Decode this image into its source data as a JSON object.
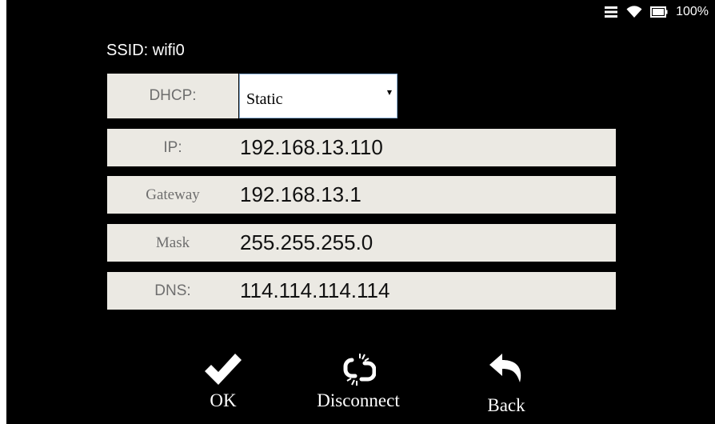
{
  "status_bar": {
    "icons": [
      "menu-icon",
      "wifi-icon",
      "battery-icon"
    ],
    "battery_percent": "100%"
  },
  "ssid": "SSID: wifi0",
  "dhcp": {
    "label": "DHCP:",
    "selected": "Static"
  },
  "fields": {
    "ip": {
      "label": "IP:",
      "value": "192.168.13.110"
    },
    "gateway": {
      "label": "Gateway",
      "value": "192.168.13.1"
    },
    "mask": {
      "label": "Mask",
      "value": "255.255.255.0"
    },
    "dns": {
      "label": "DNS:",
      "value": "114.114.114.114"
    }
  },
  "actions": {
    "ok": {
      "label": "OK",
      "icon": "checkmark-icon"
    },
    "disconnect": {
      "label": "Disconnect",
      "icon": "broken-link-icon"
    },
    "back": {
      "label": "Back",
      "icon": "reply-arrow-icon"
    }
  },
  "colors": {
    "background": "#000000",
    "field_background": "#ebe9e3",
    "label_text": "#6e6e6e",
    "select_border": "#8ab0d6"
  }
}
